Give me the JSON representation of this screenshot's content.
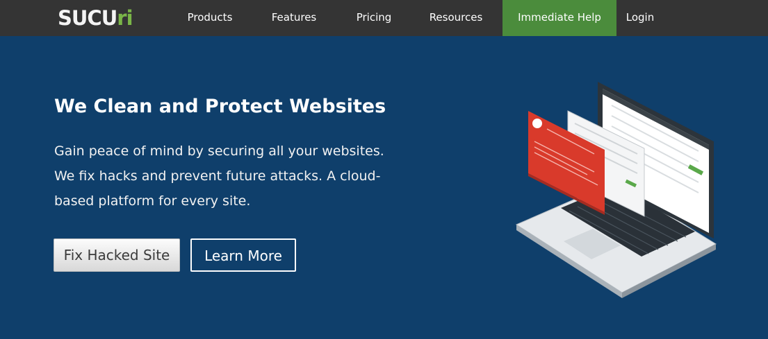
{
  "nav": {
    "logo_main": "SUCU",
    "logo_accent": "ri",
    "items": [
      "Products",
      "Features",
      "Pricing",
      "Resources"
    ],
    "help_label": "Immediate Help",
    "login_label": "Login"
  },
  "hero": {
    "title": "We Clean and Protect Websites",
    "subtitle_lines": [
      "Gain peace of mind by securing all your websites.",
      "We fix hacks and prevent future attacks. A cloud-",
      "based platform for every site."
    ],
    "fix_button": "Fix Hacked Site",
    "learn_button": "Learn More"
  },
  "colors": {
    "nav_bg": "#343434",
    "hero_bg": "#0f3f6b",
    "help_bg": "#4b8c3c",
    "alert_red": "#d93a2b"
  },
  "icons": [
    "laptop-illustration",
    "alert-x-icon"
  ]
}
